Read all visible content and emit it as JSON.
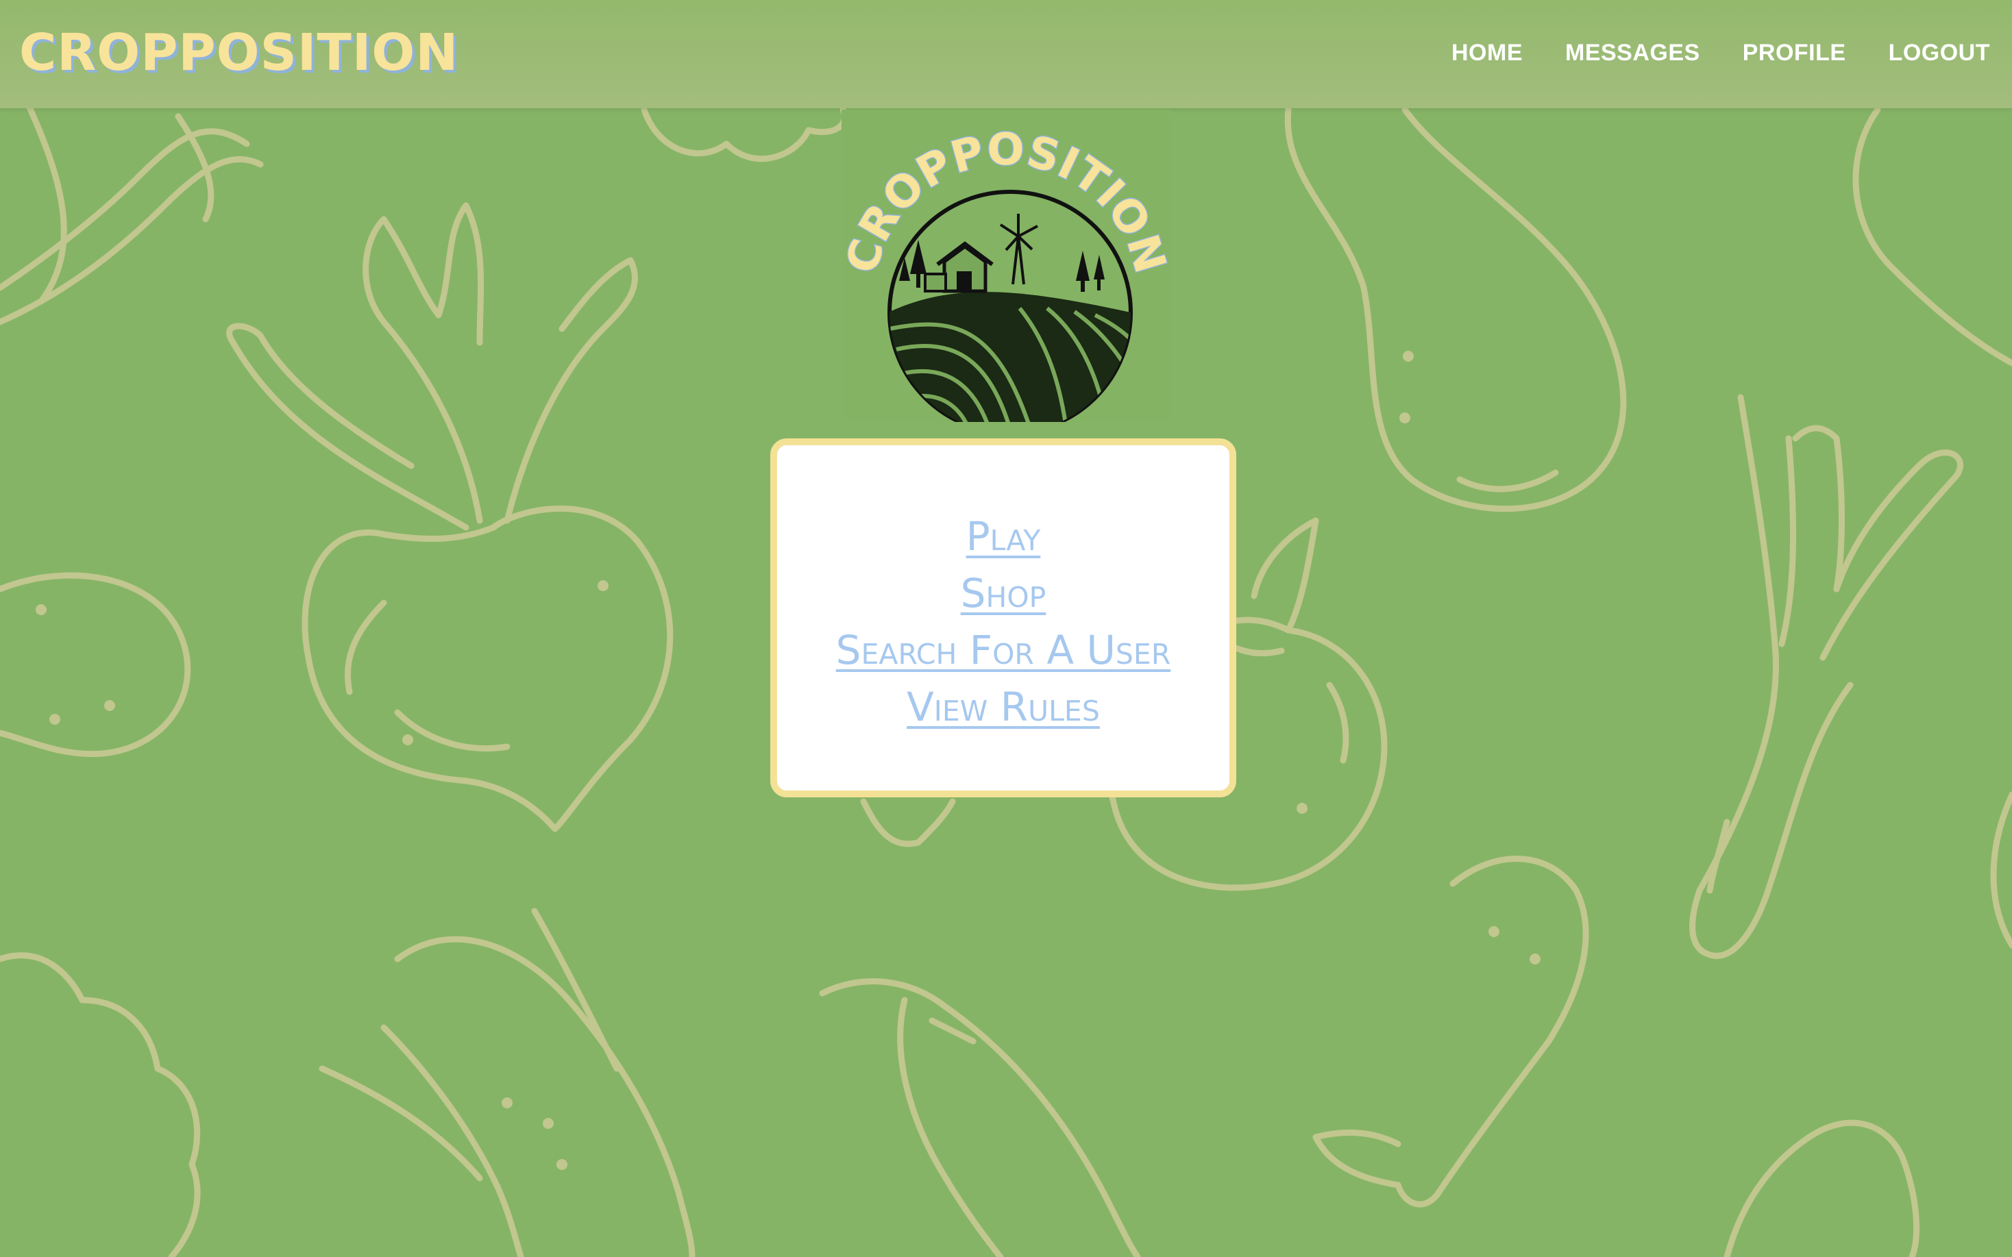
{
  "header": {
    "brand": "CROPPOSITION",
    "nav": [
      {
        "label": "HOME"
      },
      {
        "label": "MESSAGES"
      },
      {
        "label": "PROFILE"
      },
      {
        "label": "LOGOUT"
      }
    ]
  },
  "logo": {
    "text": "CROPPOSITION"
  },
  "menu": {
    "items": [
      {
        "label": "Play"
      },
      {
        "label": "Shop"
      },
      {
        "label": "Search For A User"
      },
      {
        "label": "View Rules"
      }
    ]
  },
  "colors": {
    "background": "#86b466",
    "navbar": "#9ebb77",
    "brand_text": "#f8e39a",
    "brand_shadow": "#8fb3d9",
    "card_border": "#f3e196",
    "link": "#a6c8ef",
    "doodle": "#c1c78f"
  }
}
